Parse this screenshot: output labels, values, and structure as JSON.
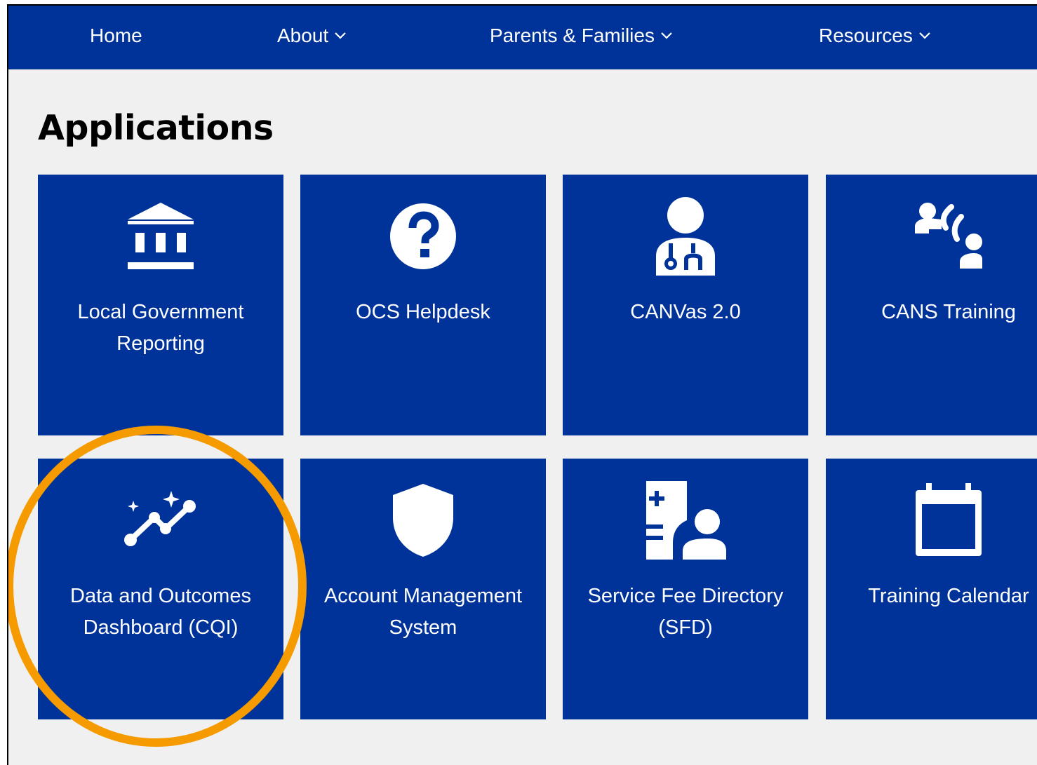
{
  "nav": {
    "items": [
      {
        "label": "Home",
        "has_dropdown": false
      },
      {
        "label": "About",
        "has_dropdown": true
      },
      {
        "label": "Parents & Families",
        "has_dropdown": true
      },
      {
        "label": "Resources",
        "has_dropdown": true
      }
    ]
  },
  "page": {
    "title": "Applications"
  },
  "tiles": [
    {
      "label": "Local Government Reporting",
      "icon": "government-building-icon"
    },
    {
      "label": "OCS Helpdesk",
      "icon": "help-question-icon"
    },
    {
      "label": "CANVas 2.0",
      "icon": "doctor-icon"
    },
    {
      "label": "CANS Training",
      "icon": "support-headset-icon"
    },
    {
      "label": "Data and Outcomes Dashboard (CQI)",
      "icon": "analytics-sparkle-icon"
    },
    {
      "label": "Account Management System",
      "icon": "shield-icon"
    },
    {
      "label": "Service Fee Directory (SFD)",
      "icon": "medical-record-person-icon"
    },
    {
      "label": "Training Calendar",
      "icon": "calendar-icon"
    }
  ],
  "colors": {
    "brand_blue": "#00339a",
    "page_background": "#f0f0f0",
    "highlight_orange": "#f59b00"
  },
  "highlight": {
    "target": "Data and Outcomes Dashboard (CQI)"
  }
}
